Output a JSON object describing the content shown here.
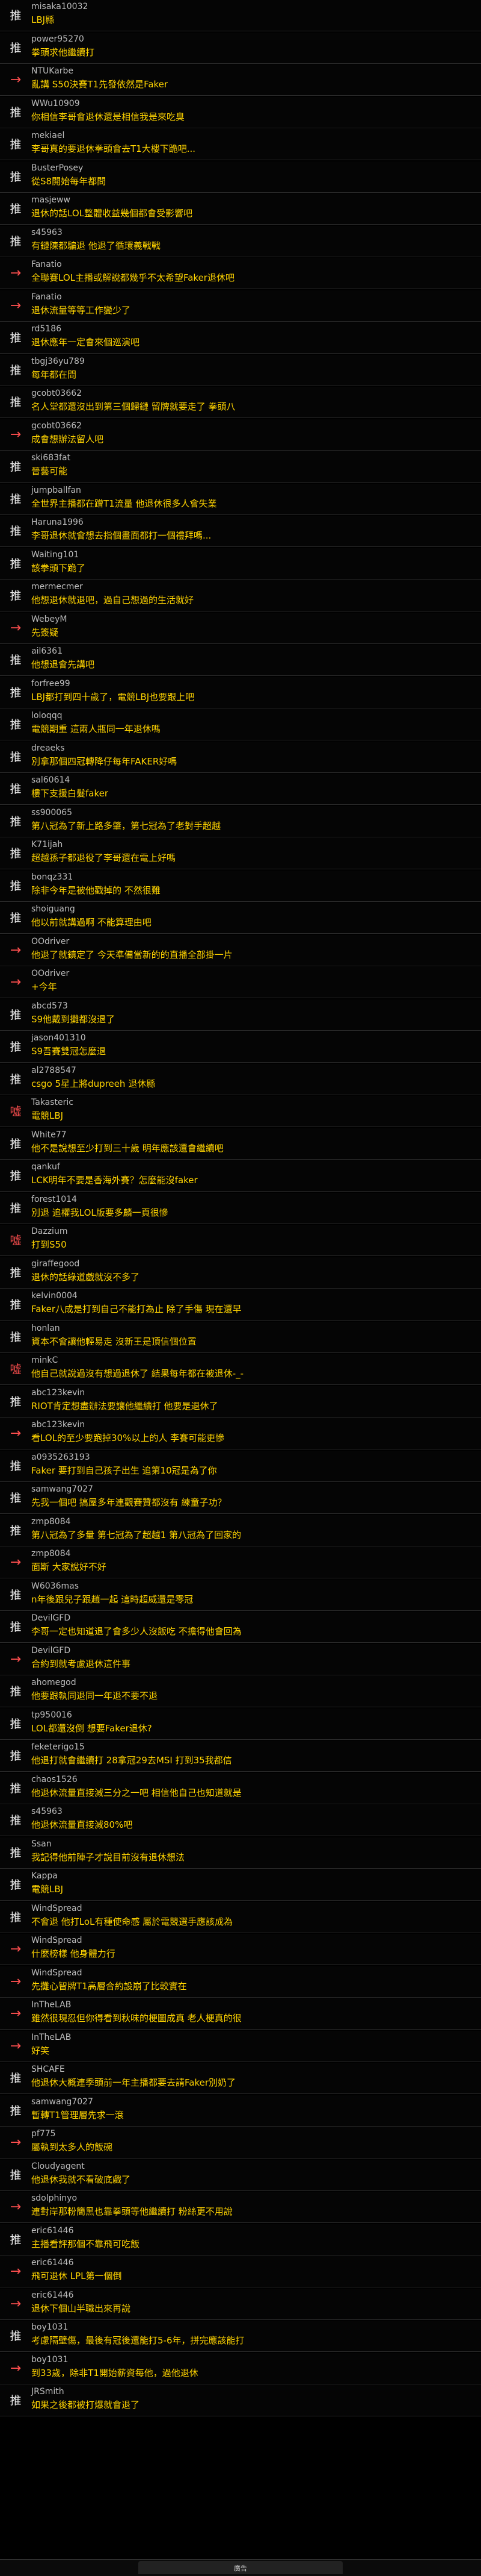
{
  "comments": [
    {
      "tag": "推",
      "user": "misaka10032",
      "text": "LBJ縣"
    },
    {
      "tag": "推",
      "user": "power95270",
      "text": "拳頭求他繼續打"
    },
    {
      "tag": "→",
      "user": "NTUKarbe",
      "text": "亂講 S50決賽T1先發依然是Faker"
    },
    {
      "tag": "推",
      "user": "WWu10909",
      "text": "你相信李哥會退休還是相信我是來吃臭"
    },
    {
      "tag": "推",
      "user": "mekiael",
      "text": "李哥真的要退休拳頭會去T1大樓下跪吧..."
    },
    {
      "tag": "推",
      "user": "BusterPosey",
      "text": "從S8開始每年都問"
    },
    {
      "tag": "推",
      "user": "masjeww",
      "text": "退休的話LOL整體收益幾個都會受影響吧"
    },
    {
      "tag": "推",
      "user": "s45963",
      "text": "有鏈陳都騙退 他退了循環義戰戰"
    },
    {
      "tag": "→",
      "user": "Fanatio",
      "text": "全聯賽LOL主播或解說都幾乎不太希望Faker退休吧"
    },
    {
      "tag": "→",
      "user": "Fanatio",
      "text": "退休流量等等工作變少了"
    },
    {
      "tag": "推",
      "user": "rd5186",
      "text": "退休應年一定會來個巡演吧"
    },
    {
      "tag": "推",
      "user": "tbgj36yu789",
      "text": "每年都在問"
    },
    {
      "tag": "推",
      "user": "gcobt03662",
      "text": "名人堂都還沒出到第三個歸鏈 留牌就要走了 拳頭八"
    },
    {
      "tag": "→",
      "user": "gcobt03662",
      "text": "成會想辦法留人吧"
    },
    {
      "tag": "推",
      "user": "ski683fat",
      "text": "晉藝可能"
    },
    {
      "tag": "推",
      "user": "jumpballfan",
      "text": "全世界主播都在蹭T1流量 他退休很多人會失業"
    },
    {
      "tag": "推",
      "user": "Haruna1996",
      "text": "李哥退休就會想去指個畫面都打一個禮拜嗎..."
    },
    {
      "tag": "推",
      "user": "Waiting101",
      "text": "該拳頭下跪了"
    },
    {
      "tag": "推",
      "user": "mermecmer",
      "text": "他想退休就退吧，過自己想過的生活就好"
    },
    {
      "tag": "→",
      "user": "WebeyM",
      "text": "先簽疑"
    },
    {
      "tag": "推",
      "user": "ail6361",
      "text": "他想退會先講吧"
    },
    {
      "tag": "推",
      "user": "forfree99",
      "text": "LBJ都打到四十歲了，電競LBJ也要跟上吧"
    },
    {
      "tag": "推",
      "user": "loloqqq",
      "text": "電競期重 這兩人瓶同一年退休嗎"
    },
    {
      "tag": "推",
      "user": "dreaeks",
      "text": "別拿那個四冠轉降仔每年FAKER好嗎"
    },
    {
      "tag": "推",
      "user": "sal60614",
      "text": "樓下支援白髮faker"
    },
    {
      "tag": "推",
      "user": "ss900065",
      "text": "第八冠為了新上路多肇，第七冠為了老對手超越"
    },
    {
      "tag": "推",
      "user": "K71ijah",
      "text": "超越孫子都退役了李哥還在電上好嗎"
    },
    {
      "tag": "推",
      "user": "bonqz331",
      "text": "除非今年是被他戳掉的 不然很難"
    },
    {
      "tag": "推",
      "user": "shoiguang",
      "text": "他以前就講過啊 不能算理由吧"
    },
    {
      "tag": "→",
      "user": "OOdriver",
      "text": "他退了就鎮定了 今天準備當新的的直播全部掛一片"
    },
    {
      "tag": "→",
      "user": "OOdriver",
      "text": "+今年"
    },
    {
      "tag": "推",
      "user": "abcd573",
      "text": "S9他戴到攤都沒退了"
    },
    {
      "tag": "推",
      "user": "jason401310",
      "text": "S9吾賽雙冠怎麼退"
    },
    {
      "tag": "推",
      "user": "al2788547",
      "text": "csgo 5星上將dupreeh 退休縣"
    },
    {
      "tag": "噓",
      "user": "Takasteric",
      "text": "電競LBJ"
    },
    {
      "tag": "推",
      "user": "White77",
      "text": "他不是說想至少打到三十歲 明年應該還會繼續吧"
    },
    {
      "tag": "推",
      "user": "qankuf",
      "text": "LCK明年不要是香海外賽？怎麼能沒faker"
    },
    {
      "tag": "推",
      "user": "forest1014",
      "text": "別退 追權我LOL版要多麟一頁很慘"
    },
    {
      "tag": "噓",
      "user": "Dazzium",
      "text": "打到S50"
    },
    {
      "tag": "推",
      "user": "giraffegood",
      "text": "退休的話綠道戲就沒不多了"
    },
    {
      "tag": "推",
      "user": "kelvin0004",
      "text": "Faker八成是打到自己不能打為止 除了手傷 現在還早"
    },
    {
      "tag": "推",
      "user": "honlan",
      "text": "資本不會讓他輕易走 沒新王是頂信個位置"
    },
    {
      "tag": "噓",
      "user": "minkC",
      "text": "他自己就說過沒有想過退休了 結果每年都在被退休-_-"
    },
    {
      "tag": "推",
      "user": "abc123kevin",
      "text": "RIOT肯定想盡辦法要讓他繼續打 他要是退休了"
    },
    {
      "tag": "→",
      "user": "abc123kevin",
      "text": "看LOL的至少要跑掉30%以上的人 李賽可能更慘"
    },
    {
      "tag": "推",
      "user": "a0935263193",
      "text": "Faker 要打到自己孩子出生 追第10冠是為了你"
    },
    {
      "tag": "推",
      "user": "samwang7027",
      "text": "先我一個吧 搞屋多年連觀賽贊都沒有 練童子功？"
    },
    {
      "tag": "推",
      "user": "zmp8084",
      "text": "第八冠為了多量 第七冠為了超越1 第八冠為了回家的"
    },
    {
      "tag": "→",
      "user": "zmp8084",
      "text": "面斯 大家說好不好"
    },
    {
      "tag": "推",
      "user": "W6036mas",
      "text": "n年後跟兒子跟趙一起 這時超威還是零冠"
    },
    {
      "tag": "推",
      "user": "DevilGFD",
      "text": "李哥一定也知道退了會多少人沒飯吃 不擔得他會回為"
    },
    {
      "tag": "→",
      "user": "DevilGFD",
      "text": "合約到就考慮退休這件事"
    },
    {
      "tag": "推",
      "user": "ahomegod",
      "text": "他要跟執同退同一年退不要不退"
    },
    {
      "tag": "推",
      "user": "tp950016",
      "text": "LOL都還沒倒 想要Faker退休?"
    },
    {
      "tag": "推",
      "user": "feketerigo15",
      "text": "他退打就會繼續打 28拿冠29去MSI 打到35我都信"
    },
    {
      "tag": "推",
      "user": "chaos1526",
      "text": "他退休流量直接減三分之一吧 相信他自己也知道就是"
    },
    {
      "tag": "推",
      "user": "s45963",
      "text": "他退休流量直接減80%吧"
    },
    {
      "tag": "推",
      "user": "Ssan",
      "text": "我記得他前陣子才說目前沒有退休想法"
    },
    {
      "tag": "推",
      "user": "Kappa",
      "text": "電競LBJ"
    },
    {
      "tag": "推",
      "user": "WindSpread",
      "text": "不會退 他打LoL有種使命感 屬於電競選手應該成為"
    },
    {
      "tag": "→",
      "user": "WindSpread",
      "text": "什麼榜樣 他身體力行"
    },
    {
      "tag": "→",
      "user": "WindSpread",
      "text": "先攤心智牌T1高層合約設崩了比較實在"
    },
    {
      "tag": "→",
      "user": "InTheLAB",
      "text": "雖然很現忍但你得看到秋味的梗圖成真 老人梗真的很"
    },
    {
      "tag": "→",
      "user": "InTheLAB",
      "text": "好笑"
    },
    {
      "tag": "推",
      "user": "SHCAFE",
      "text": "他退休大概連季頭前一年主播都要去請Faker別奶了"
    },
    {
      "tag": "推",
      "user": "samwang7027",
      "text": "暫轉T1管理層先求一滾"
    },
    {
      "tag": "→",
      "user": "pf775",
      "text": "屬執到太多人的飯碗"
    },
    {
      "tag": "推",
      "user": "Cloudyagent",
      "text": "他退休我就不看破底戲了"
    },
    {
      "tag": "→",
      "user": "sdolphinyo",
      "text": "連對岸那粉簡黑也靠拳頭等他繼續打 粉絲更不用說"
    },
    {
      "tag": "推",
      "user": "eric61446",
      "text": "主播看評那個不靠飛可吃飯"
    },
    {
      "tag": "→",
      "user": "eric61446",
      "text": "飛可退休 LPL第一個倒"
    },
    {
      "tag": "→",
      "user": "eric61446",
      "text": "退休下個山半職出來再說"
    },
    {
      "tag": "推",
      "user": "boy1031",
      "text": "考慮隔壁傷，最後有冠後還能打5-6年，拼完應該能打"
    },
    {
      "tag": "→",
      "user": "boy1031",
      "text": "到33歲，除非T1開始薪資每他，過他退休"
    },
    {
      "tag": "推",
      "user": "JRSmith",
      "text": "如果之後都被打爆就會退了"
    }
  ],
  "footer": {
    "label": "廣告"
  }
}
